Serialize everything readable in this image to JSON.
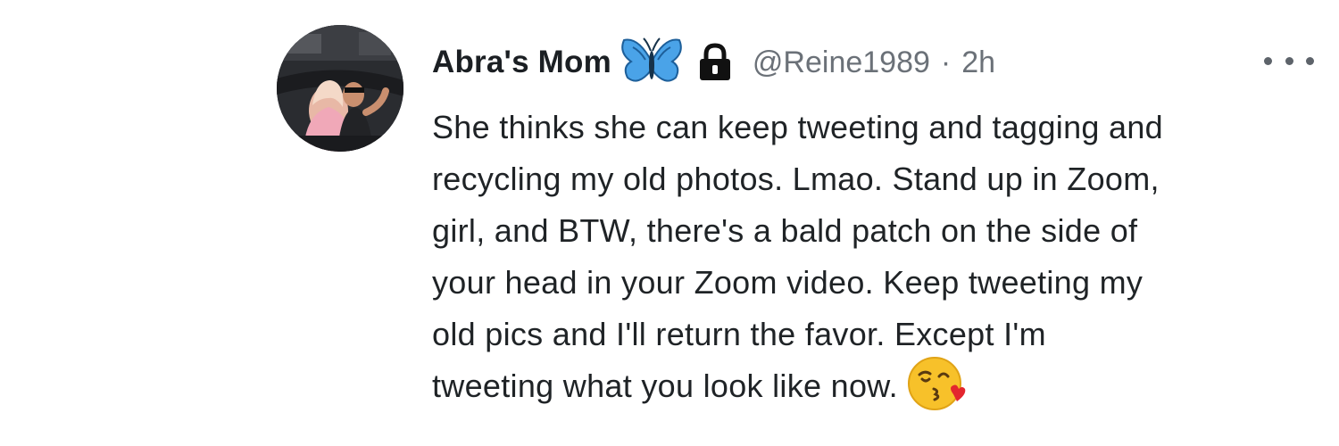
{
  "tweet": {
    "display_name": "Abra's Mom",
    "badges": [
      "butterfly-icon",
      "lock-icon"
    ],
    "handle": "@Reine1989",
    "separator": "·",
    "time": "2h",
    "more_icon": "more-horizontal-icon",
    "body": "She thinks she can keep tweeting and tagging and\nrecycling my old photos. Lmao. Stand up in Zoom,\ngirl, and BTW, there's a bald patch on the side of\nyour head in your Zoom video. Keep tweeting my\nold pics and I'll return the favor. Except I'm\ntweeting what you look like now.",
    "emoji": "face-blowing-a-kiss-icon"
  },
  "colors": {
    "text": "#1f2326",
    "muted": "#6b7178",
    "butterfly": "#4aa3e8"
  }
}
